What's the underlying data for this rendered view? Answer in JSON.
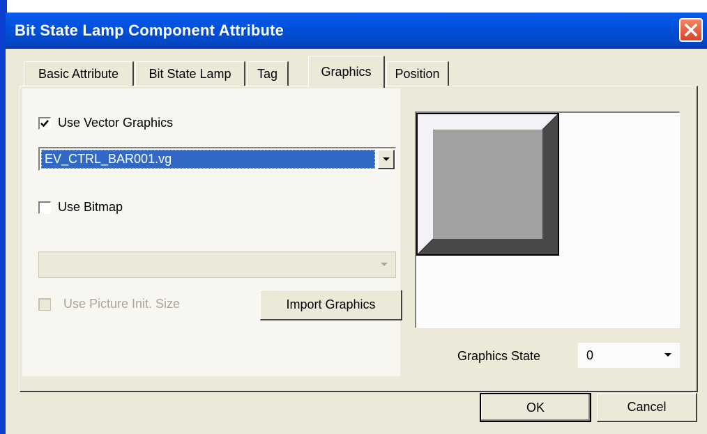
{
  "window": {
    "title": "Bit State Lamp Component Attribute"
  },
  "tabs": [
    {
      "label": "Basic Attribute"
    },
    {
      "label": "Bit State Lamp"
    },
    {
      "label": "Tag"
    },
    {
      "label": "Graphics",
      "active": true
    },
    {
      "label": "Position"
    }
  ],
  "graphics": {
    "use_vector": {
      "label": "Use Vector Graphics",
      "checked": true
    },
    "vector_select": {
      "value": "EV_CTRL_BAR001.vg"
    },
    "use_bitmap": {
      "label": "Use Bitmap",
      "checked": false
    },
    "bitmap_select": {
      "value": ""
    },
    "use_picture_init": {
      "label": "Use Picture Init. Size",
      "checked": false,
      "enabled": false
    },
    "import_button": "Import Graphics",
    "state_label": "Graphics State",
    "state_value": "0"
  },
  "preview": {
    "icon": "bevel-square-graphic",
    "colors": {
      "face": "#a0a2a0",
      "shadow": "#4a484a",
      "highlight": "#f4f2f6",
      "background": "#fbfbfb"
    }
  },
  "footer": {
    "ok": "OK",
    "cancel": "Cancel"
  },
  "colors": {
    "title_bar": "#0052e0",
    "selection": "#316ac5",
    "dialog": "#ece9d8"
  }
}
